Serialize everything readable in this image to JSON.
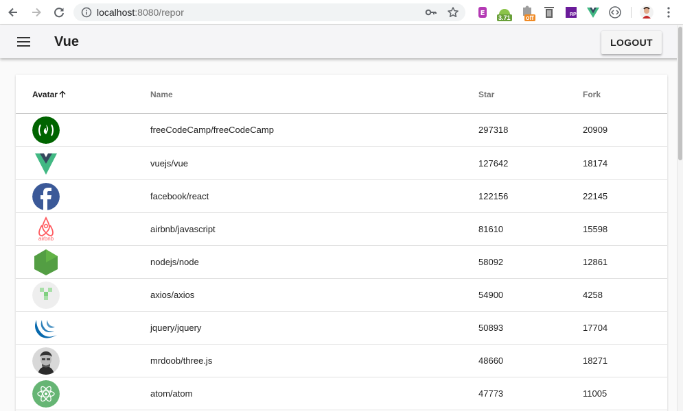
{
  "browser": {
    "url_host": "localhost",
    "url_rest": ":8080/repor",
    "extensions": [
      {
        "icon": "evernote-clipper-icon"
      },
      {
        "icon": "android-robot-icon",
        "badge": "3.71"
      },
      {
        "icon": "extension-off-icon",
        "badge": "off"
      },
      {
        "icon": "trash-icon"
      },
      {
        "icon": "rp-icon",
        "badge": "RP"
      },
      {
        "icon": "vue-devtools-icon"
      },
      {
        "icon": "code-icon"
      },
      {
        "icon": "profile-avatar-icon"
      }
    ]
  },
  "app": {
    "title": "Vue",
    "logout_label": "LOGOUT"
  },
  "table": {
    "columns": [
      {
        "label": "Avatar",
        "sorted": "asc"
      },
      {
        "label": "Name"
      },
      {
        "label": "Star"
      },
      {
        "label": "Fork"
      }
    ],
    "rows": [
      {
        "avatar": "freecodecamp-logo",
        "name": "freeCodeCamp/freeCodeCamp",
        "star": "297318",
        "fork": "20909"
      },
      {
        "avatar": "vue-logo",
        "name": "vuejs/vue",
        "star": "127642",
        "fork": "18174"
      },
      {
        "avatar": "facebook-logo",
        "name": "facebook/react",
        "star": "122156",
        "fork": "22145"
      },
      {
        "avatar": "airbnb-logo",
        "name": "airbnb/javascript",
        "star": "81610",
        "fork": "15598"
      },
      {
        "avatar": "nodejs-logo",
        "name": "nodejs/node",
        "star": "58092",
        "fork": "12861"
      },
      {
        "avatar": "axios-logo",
        "name": "axios/axios",
        "star": "54900",
        "fork": "4258"
      },
      {
        "avatar": "jquery-logo",
        "name": "jquery/jquery",
        "star": "50893",
        "fork": "17704"
      },
      {
        "avatar": "mrdoob-photo",
        "name": "mrdoob/three.js",
        "star": "48660",
        "fork": "18271"
      },
      {
        "avatar": "atom-logo",
        "name": "atom/atom",
        "star": "47773",
        "fork": "11005"
      }
    ],
    "airbnb_wordmark": "airbnb"
  },
  "colors": {
    "toolbar_bg": "#f5f5f7",
    "freecodecamp": "#006400",
    "vue_green": "#41b883",
    "vue_dark": "#35495e",
    "facebook": "#3b5998",
    "airbnb": "#ff5a5f",
    "node": "#539e43",
    "jquery": "#0769ad",
    "atom": "#66b574"
  }
}
